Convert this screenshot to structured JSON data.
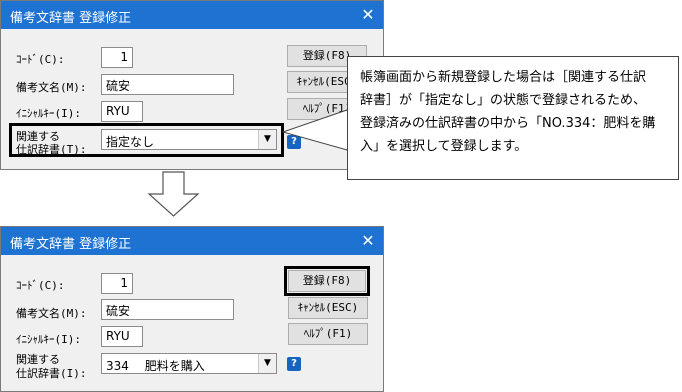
{
  "top_dialog": {
    "title": "備考文辞書 登録修正",
    "close_glyph": "✕",
    "code_label": "ｺｰﾄﾞ(C):",
    "code_value": "1",
    "name_label": "備考文名(M):",
    "name_value": "硫安",
    "initial_label": "ｲﾆｼｬﾙｷｰ(I):",
    "initial_value": "RYU",
    "related_label_1": "関連する",
    "related_label_2": "仕訳辞書(T):",
    "related_value": "指定なし",
    "register_button": "登録(F8)",
    "cancel_button": "ｷｬﾝｾﾙ(ESC)",
    "help_button": "ﾍﾙﾌﾟ(F1)",
    "help_icon": "?"
  },
  "callout": {
    "lines": [
      "帳簿画面から新規登録した場合は［関連する仕訳",
      "辞書］が「指定なし」の状態で登録されるため、",
      "登録済みの仕訳辞書の中から「NO.334：肥料を購",
      "入」を選択して登録します。"
    ]
  },
  "bottom_dialog": {
    "title": "備考文辞書 登録修正",
    "close_glyph": "✕",
    "code_label": "ｺｰﾄﾞ(C):",
    "code_value": "1",
    "name_label": "備考文名(M):",
    "name_value": "硫安",
    "initial_label": "ｲﾆｼｬﾙｷｰ(I):",
    "initial_value": "RYU",
    "related_label_1": "関連する",
    "related_label_2": "仕訳辞書(I):",
    "related_value": "334　 肥料を購入",
    "register_button": "登録(F8)",
    "cancel_button": "ｷｬﾝｾﾙ(ESC)",
    "help_button": "ﾍﾙﾌﾟ(F1)",
    "help_icon": "?"
  },
  "colors": {
    "titlebar": "#1e73d2",
    "highlight_border": "#000000",
    "help_icon_bg": "#1565c0"
  }
}
